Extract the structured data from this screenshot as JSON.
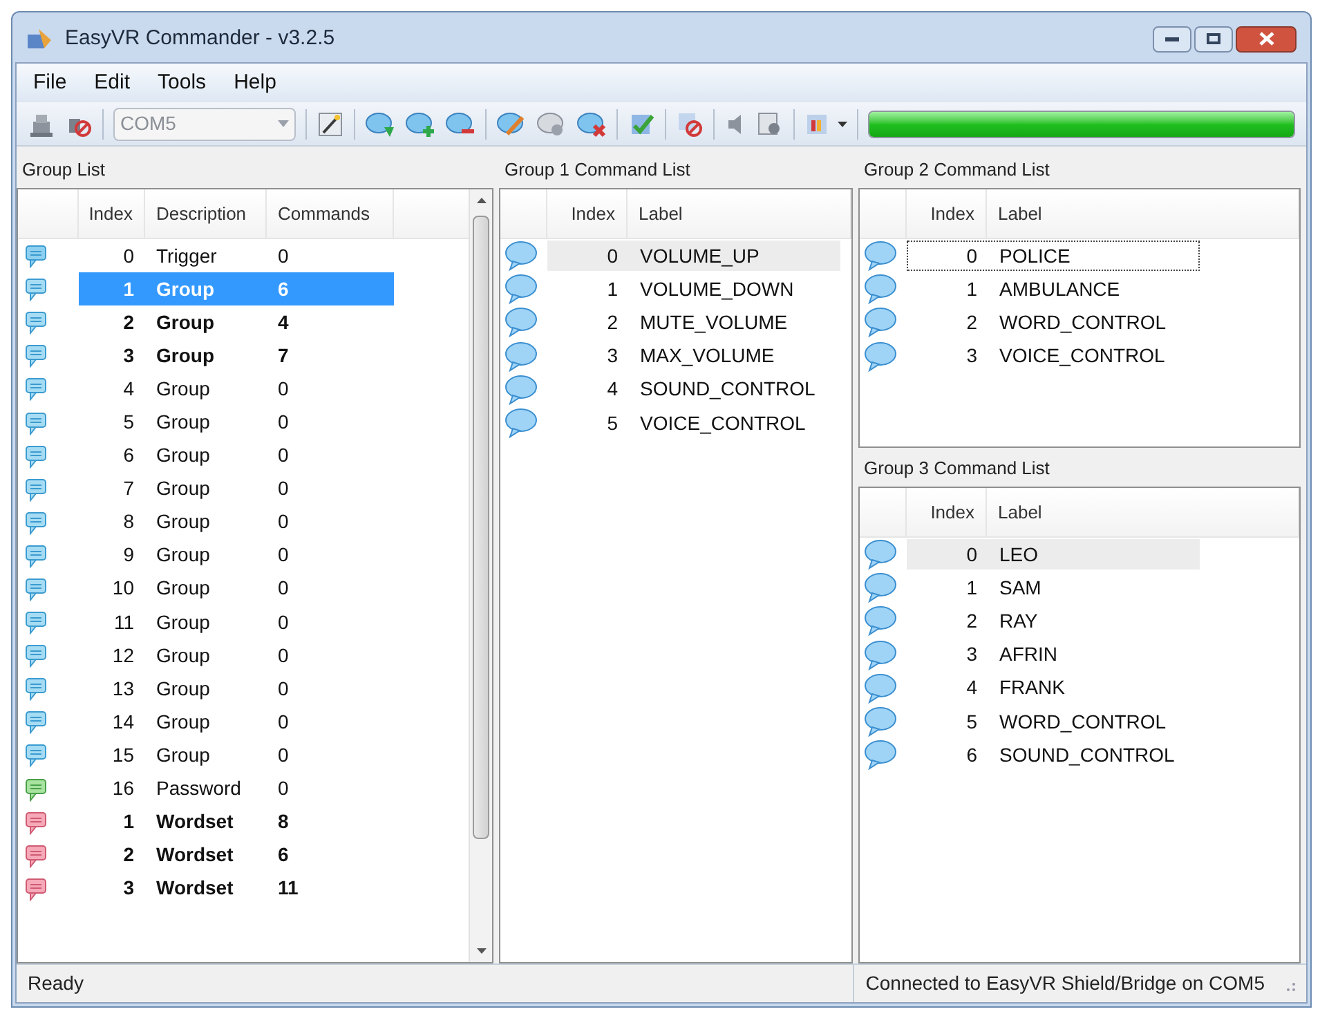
{
  "window": {
    "title": "EasyVR Commander - v3.2.5"
  },
  "menu": [
    "File",
    "Edit",
    "Tools",
    "Help"
  ],
  "toolbar": {
    "port": {
      "value": "COM5",
      "disabled": true
    },
    "progress": {
      "level": 1
    }
  },
  "group_list": {
    "title": "Group List",
    "columns": [
      "Index",
      "Description",
      "Commands"
    ],
    "rows": [
      {
        "kind": "trigger",
        "index": "0",
        "description": "Trigger",
        "commands": "0",
        "bold": false,
        "selected": false
      },
      {
        "kind": "group",
        "index": "1",
        "description": "Group",
        "commands": "6",
        "bold": true,
        "selected": true
      },
      {
        "kind": "group",
        "index": "2",
        "description": "Group",
        "commands": "4",
        "bold": true,
        "selected": false
      },
      {
        "kind": "group",
        "index": "3",
        "description": "Group",
        "commands": "7",
        "bold": true,
        "selected": false
      },
      {
        "kind": "group",
        "index": "4",
        "description": "Group",
        "commands": "0",
        "bold": false,
        "selected": false
      },
      {
        "kind": "group",
        "index": "5",
        "description": "Group",
        "commands": "0",
        "bold": false,
        "selected": false
      },
      {
        "kind": "group",
        "index": "6",
        "description": "Group",
        "commands": "0",
        "bold": false,
        "selected": false
      },
      {
        "kind": "group",
        "index": "7",
        "description": "Group",
        "commands": "0",
        "bold": false,
        "selected": false
      },
      {
        "kind": "group",
        "index": "8",
        "description": "Group",
        "commands": "0",
        "bold": false,
        "selected": false
      },
      {
        "kind": "group",
        "index": "9",
        "description": "Group",
        "commands": "0",
        "bold": false,
        "selected": false
      },
      {
        "kind": "group",
        "index": "10",
        "description": "Group",
        "commands": "0",
        "bold": false,
        "selected": false
      },
      {
        "kind": "group",
        "index": "11",
        "description": "Group",
        "commands": "0",
        "bold": false,
        "selected": false
      },
      {
        "kind": "group",
        "index": "12",
        "description": "Group",
        "commands": "0",
        "bold": false,
        "selected": false
      },
      {
        "kind": "group",
        "index": "13",
        "description": "Group",
        "commands": "0",
        "bold": false,
        "selected": false
      },
      {
        "kind": "group",
        "index": "14",
        "description": "Group",
        "commands": "0",
        "bold": false,
        "selected": false
      },
      {
        "kind": "group",
        "index": "15",
        "description": "Group",
        "commands": "0",
        "bold": false,
        "selected": false
      },
      {
        "kind": "password",
        "index": "16",
        "description": "Password",
        "commands": "0",
        "bold": false,
        "selected": false
      },
      {
        "kind": "wordset",
        "index": "1",
        "description": "Wordset",
        "commands": "8",
        "bold": true,
        "selected": false
      },
      {
        "kind": "wordset",
        "index": "2",
        "description": "Wordset",
        "commands": "6",
        "bold": true,
        "selected": false
      },
      {
        "kind": "wordset",
        "index": "3",
        "description": "Wordset",
        "commands": "11",
        "bold": true,
        "selected": false
      }
    ]
  },
  "command_lists": [
    {
      "title": "Group 1 Command List",
      "columns": [
        "Index",
        "Label"
      ],
      "rows": [
        {
          "index": "0",
          "label": "VOLUME_UP",
          "selected": true,
          "focused": false
        },
        {
          "index": "1",
          "label": "VOLUME_DOWN",
          "selected": false,
          "focused": false
        },
        {
          "index": "2",
          "label": "MUTE_VOLUME",
          "selected": false,
          "focused": false
        },
        {
          "index": "3",
          "label": "MAX_VOLUME",
          "selected": false,
          "focused": false
        },
        {
          "index": "4",
          "label": "SOUND_CONTROL",
          "selected": false,
          "focused": false
        },
        {
          "index": "5",
          "label": "VOICE_CONTROL",
          "selected": false,
          "focused": false
        }
      ]
    },
    {
      "title": "Group 2 Command List",
      "columns": [
        "Index",
        "Label"
      ],
      "rows": [
        {
          "index": "0",
          "label": "POLICE",
          "selected": false,
          "focused": true
        },
        {
          "index": "1",
          "label": "AMBULANCE",
          "selected": false,
          "focused": false
        },
        {
          "index": "2",
          "label": "WORD_CONTROL",
          "selected": false,
          "focused": false
        },
        {
          "index": "3",
          "label": "VOICE_CONTROL",
          "selected": false,
          "focused": false
        }
      ]
    },
    {
      "title": "Group 3 Command List",
      "columns": [
        "Index",
        "Label"
      ],
      "rows": [
        {
          "index": "0",
          "label": "LEO",
          "selected": true,
          "focused": false
        },
        {
          "index": "1",
          "label": "SAM",
          "selected": false,
          "focused": false
        },
        {
          "index": "2",
          "label": "RAY",
          "selected": false,
          "focused": false
        },
        {
          "index": "3",
          "label": "AFRIN",
          "selected": false,
          "focused": false
        },
        {
          "index": "4",
          "label": "FRANK",
          "selected": false,
          "focused": false
        },
        {
          "index": "5",
          "label": "WORD_CONTROL",
          "selected": false,
          "focused": false
        },
        {
          "index": "6",
          "label": "SOUND_CONTROL",
          "selected": false,
          "focused": false
        }
      ]
    }
  ],
  "status_bar": {
    "left": "Ready",
    "right": "Connected to EasyVR Shield/Bridge on COM5"
  }
}
